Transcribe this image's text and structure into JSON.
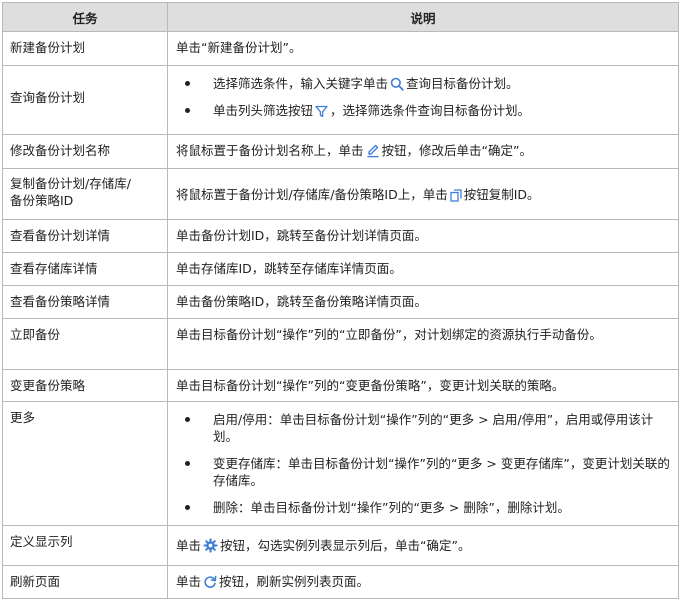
{
  "header": {
    "task": "任务",
    "desc": "说明"
  },
  "rows": {
    "r0": {
      "task": "新建备份计划",
      "desc": "单击“新建备份计划”。"
    },
    "r1": {
      "task": "查询备份计划",
      "b1a": "选择筛选条件，输入关键字单击",
      "b1b": "查询目标备份计划。",
      "b2a": "单击列头筛选按钮",
      "b2b": "，选择筛选条件查询目标备份计划。"
    },
    "r2": {
      "task": "修改备份计划名称",
      "desc_a": "将鼠标置于备份计划名称上，单击",
      "desc_b": "按钮，修改后单击“确定”。"
    },
    "r3": {
      "task": "复制备份计划/存储库/备份策略ID",
      "desc_a": "将鼠标置于备份计划/存储库/备份策略ID上，单击",
      "desc_b": "按钮复制ID。"
    },
    "r4": {
      "task": "查看备份计划详情",
      "desc": "单击备份计划ID，跳转至备份计划详情页面。"
    },
    "r5": {
      "task": "查看存储库详情",
      "desc": "单击存储库ID，跳转至存储库详情页面。"
    },
    "r6": {
      "task": "查看备份策略详情",
      "desc": "单击备份策略ID，跳转至备份策略详情页面。"
    },
    "r7": {
      "task": "立即备份",
      "desc": "单击目标备份计划“操作”列的“立即备份”，对计划绑定的资源执行手动备份。"
    },
    "r8": {
      "task": "变更备份策略",
      "desc": "单击目标备份计划“操作”列的“变更备份策略”，变更计划关联的策略。"
    },
    "r9": {
      "task": "更多",
      "b1": "启用/停用：单击目标备份计划“操作”列的“更多 > 启用/停用”，启用或停用该计划。",
      "b2": "变更存储库：单击目标备份计划“操作”列的“更多 > 变更存储库”，变更计划关联的存储库。",
      "b3": "删除：单击目标备份计划“操作”列的“更多 > 删除”，删除计划。"
    },
    "r10": {
      "task": "定义显示列",
      "desc_a": "单击",
      "desc_b": "按钮，勾选实例列表显示列后，单击“确定”。"
    },
    "r11": {
      "task": "刷新页面",
      "desc_a": "单击",
      "desc_b": "按钮，刷新实例列表页面。"
    }
  },
  "icons": {
    "search": "search-icon",
    "filter": "filter-icon",
    "edit": "edit-icon",
    "copy": "copy-icon",
    "settings": "gear-icon",
    "refresh": "refresh-icon"
  },
  "colors": {
    "icon": "#3f7fd6",
    "header_bg": "#dedede",
    "border": "#b9b9b9"
  }
}
